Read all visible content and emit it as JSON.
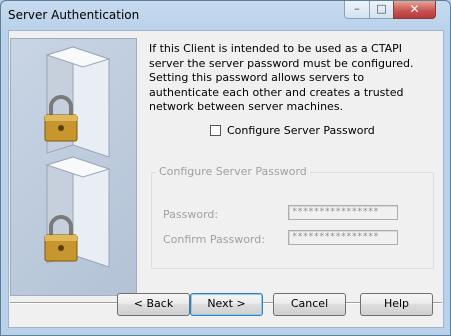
{
  "window": {
    "title": "Server Authentication"
  },
  "title_buttons": {
    "minimize": "–",
    "maximize": "□",
    "close": "✕"
  },
  "intro_text": "If this Client is intended to be used as a CTAPI server the server password must be configured. Setting this password allows servers to authenticate each other and creates a trusted network between server machines.",
  "configure_checkbox": {
    "label": "Configure Server Password",
    "checked": false
  },
  "group": {
    "legend": "Configure Server Password",
    "password_label": "Password:",
    "password_value": "****************",
    "confirm_label": "Confirm Password:",
    "confirm_value": "****************"
  },
  "buttons": {
    "back": "< Back",
    "next": "Next >",
    "cancel": "Cancel",
    "help": "Help"
  },
  "colors": {
    "accent": "#3c7fb1",
    "close": "#c75050",
    "panel": "#b3c2d6"
  },
  "icons": [
    "server-lock-icon",
    "server-lock-icon"
  ]
}
